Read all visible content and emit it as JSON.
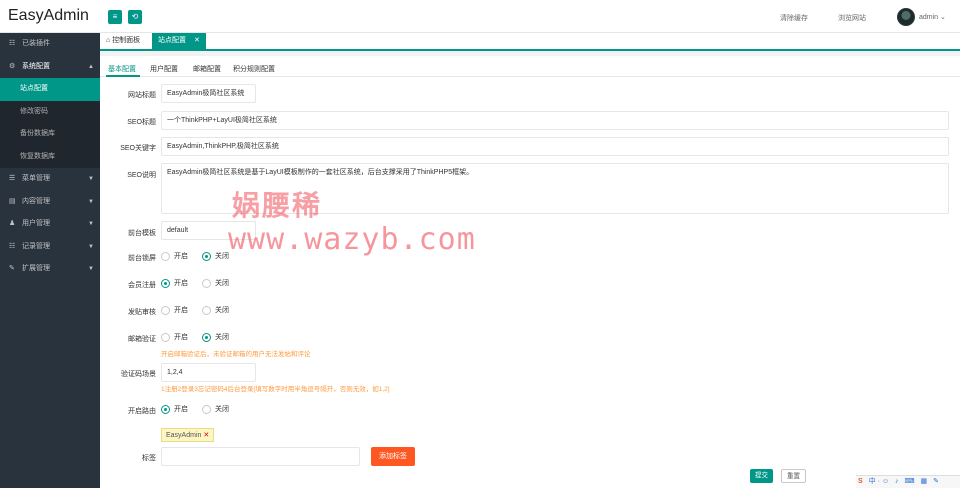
{
  "header": {
    "logo": "EasyAdmin",
    "menu_icon": "≡",
    "refresh_icon": "⟲",
    "clear_cache": "清除缓存",
    "browse_site": "浏览网站",
    "user": "admin ⌄"
  },
  "sidebar": {
    "items": [
      {
        "icon": "☷",
        "label": "已装插件"
      },
      {
        "icon": "⚙",
        "label": "系统配置",
        "arrow": "▲"
      },
      {
        "icon": "☰",
        "label": "菜单管理",
        "arrow": "▼"
      },
      {
        "icon": "▤",
        "label": "内容管理",
        "arrow": "▼"
      },
      {
        "icon": "♟",
        "label": "用户管理",
        "arrow": "▼"
      },
      {
        "icon": "☷",
        "label": "记录管理",
        "arrow": "▼"
      },
      {
        "icon": "✎",
        "label": "扩展管理",
        "arrow": "▼"
      }
    ],
    "sub": [
      "站点配置",
      "修改密码",
      "备份数据库",
      "恢复数据库"
    ]
  },
  "tabs": {
    "home_icon": "⌂",
    "home": "控制面板",
    "active": "站点配置",
    "close": "✕"
  },
  "subtabs": [
    "基本配置",
    "用户配置",
    "邮箱配置",
    "积分规则配置"
  ],
  "form": {
    "site_title_label": "网站标题",
    "site_title_value": "EasyAdmin极简社区系统",
    "seo_title_label": "SEO标题",
    "seo_title_value": "一个ThinkPHP+LayUI极简社区系统",
    "seo_keywords_label": "SEO关键字",
    "seo_keywords_value": "EasyAdmin,ThinkPHP,极简社区系统",
    "seo_desc_label": "SEO说明",
    "seo_desc_value": "EasyAdmin极简社区系统是基于LayUI模板制作的一套社区系统，后台支撑采用了ThinkPHP5框架。",
    "template_label": "前台模板",
    "template_value": "default",
    "frontend_lock_label": "前台锁屏",
    "register_label": "会员注册",
    "post_review_label": "发贴审核",
    "email_verify_label": "邮箱验证",
    "email_verify_tip": "开启邮箱验证后，未验证邮箱的用户无法发帖和评论",
    "captcha_label": "验证码场景",
    "captcha_value": "1,2,4",
    "captcha_tip": "1注册2登录3忘记密码4后台登录[填写数字时用半角逗号隔开，否则无效，如1,2]",
    "route_label": "开启路由",
    "tags_label": "标签",
    "tag_chip": "EasyAdmin",
    "tag_close": "✕",
    "add_tag": "添加标签",
    "on": "开启",
    "off": "关闭",
    "submit": "提交",
    "reset": "重置"
  },
  "watermark": {
    "line1": "娲腰稀",
    "line2": "www.wazyb.com"
  },
  "imebar": {
    "logo": "S",
    "text": "中·☺ ♪ ⌨ ▦ ✎"
  },
  "colors": {
    "accent": "#009688",
    "sidebar": "#28333e",
    "orange": "#ff5722",
    "tip": "#ff9a3c"
  }
}
